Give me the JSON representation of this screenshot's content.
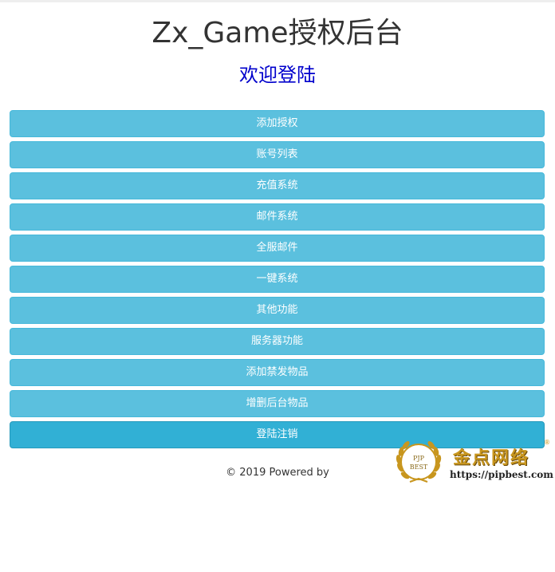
{
  "header": {
    "title": "Zx_Game授权后台",
    "subtitle": "欢迎登陆"
  },
  "menu": {
    "items": [
      {
        "label": "添加授权"
      },
      {
        "label": "账号列表"
      },
      {
        "label": "充值系统"
      },
      {
        "label": "邮件系统"
      },
      {
        "label": "全服邮件"
      },
      {
        "label": "一键系统"
      },
      {
        "label": "其他功能"
      },
      {
        "label": "服务器功能"
      },
      {
        "label": "添加禁发物品"
      },
      {
        "label": "增删后台物品"
      },
      {
        "label": "登陆注销"
      }
    ]
  },
  "footer": {
    "text": "© 2019 Powered by"
  },
  "watermark": {
    "badge_top": "PJP",
    "badge_bottom": "BEST",
    "brand_cn": "金点网络",
    "url": "https://pipbest.com",
    "reg_mark": "®",
    "color": "#c8961e"
  },
  "colors": {
    "button_bg": "#5bc0de",
    "button_active_bg": "#31b0d5",
    "subtitle": "#0000cc"
  }
}
